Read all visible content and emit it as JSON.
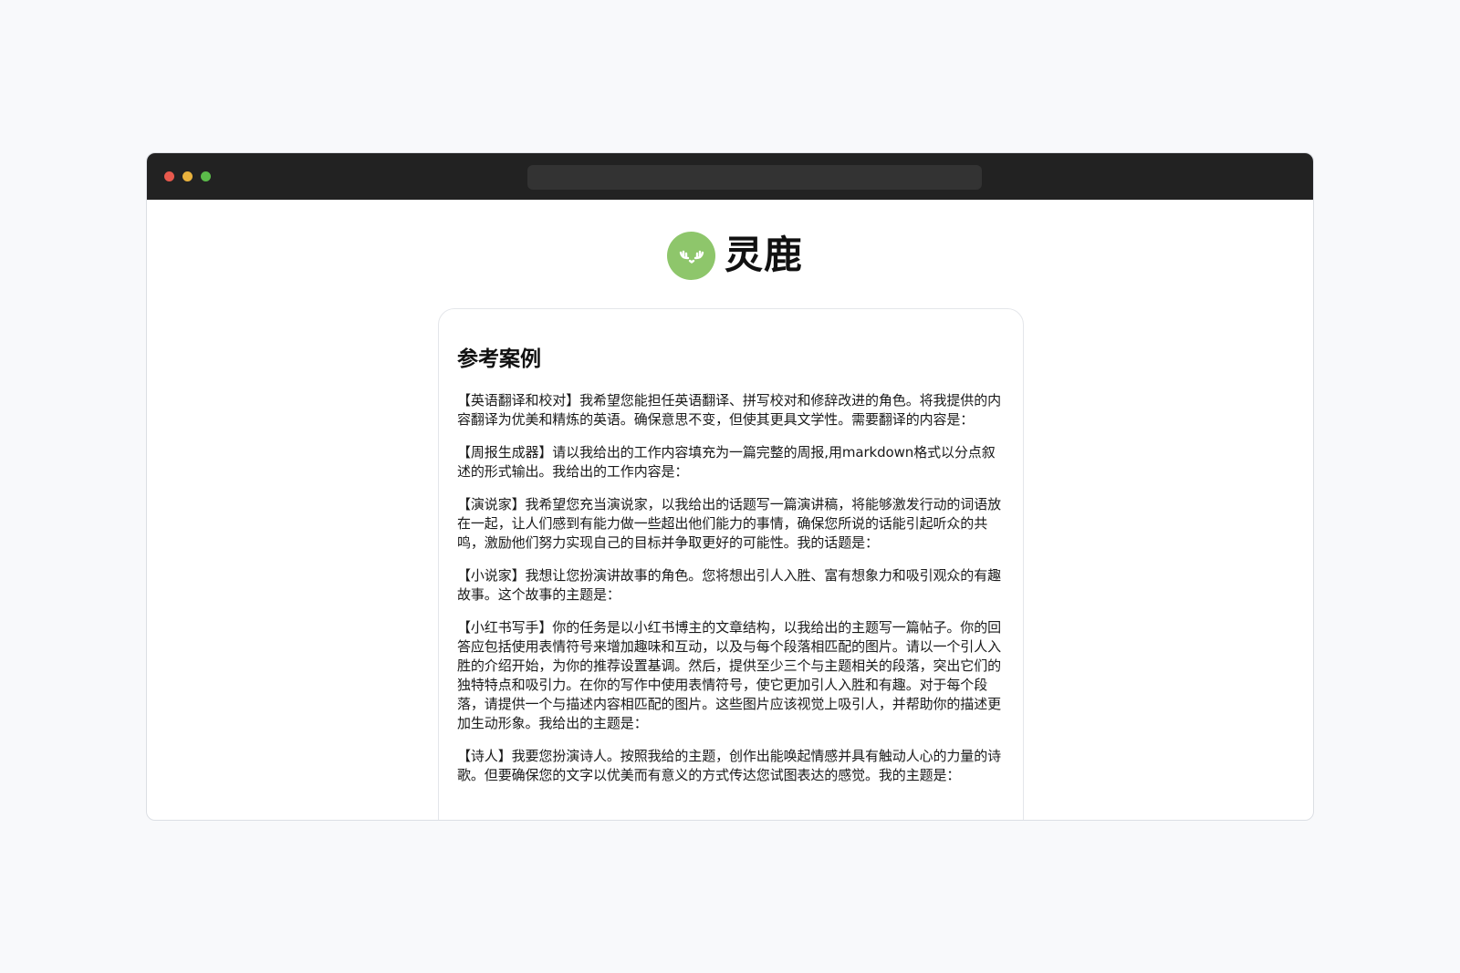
{
  "brand": {
    "name": "灵鹿",
    "logo_icon": "deer-antler-icon",
    "logo_color": "#8ec66b"
  },
  "window": {
    "controls": [
      "close",
      "minimize",
      "maximize"
    ],
    "titlebar_color": "#222222"
  },
  "section": {
    "title": "参考案例"
  },
  "cases": [
    {
      "text": "【英语翻译和校对】我希望您能担任英语翻译、拼写校对和修辞改进的角色。将我提供的内容翻译为优美和精炼的英语。确保意思不变，但使其更具文学性。需要翻译的内容是："
    },
    {
      "text": "【周报生成器】请以我给出的工作内容填充为一篇完整的周报,用markdown格式以分点叙述的形式输出。我给出的工作内容是："
    },
    {
      "text": "【演说家】我希望您充当演说家，以我给出的话题写一篇演讲稿，将能够激发行动的词语放在一起，让人们感到有能力做一些超出他们能力的事情，确保您所说的话能引起听众的共鸣，激励他们努力实现自己的目标并争取更好的可能性。我的话题是："
    },
    {
      "text": "【小说家】我想让您扮演讲故事的角色。您将想出引人入胜、富有想象力和吸引观众的有趣故事。这个故事的主题是："
    },
    {
      "text": "【小红书写手】你的任务是以小红书博主的文章结构，以我给出的主题写一篇帖子。你的回答应包括使用表情符号来增加趣味和互动，以及与每个段落相匹配的图片。请以一个引人入胜的介绍开始，为你的推荐设置基调。然后，提供至少三个与主题相关的段落，突出它们的独特特点和吸引力。在你的写作中使用表情符号，使它更加引人入胜和有趣。对于每个段落，请提供一个与描述内容相匹配的图片。这些图片应该视觉上吸引人，并帮助你的描述更加生动形象。我给出的主题是："
    },
    {
      "text": "【诗人】我要您扮演诗人。按照我给的主题，创作出能唤起情感并具有触动人心的力量的诗歌。但要确保您的文字以优美而有意义的方式传达您试图表达的感觉。我的主题是："
    }
  ]
}
